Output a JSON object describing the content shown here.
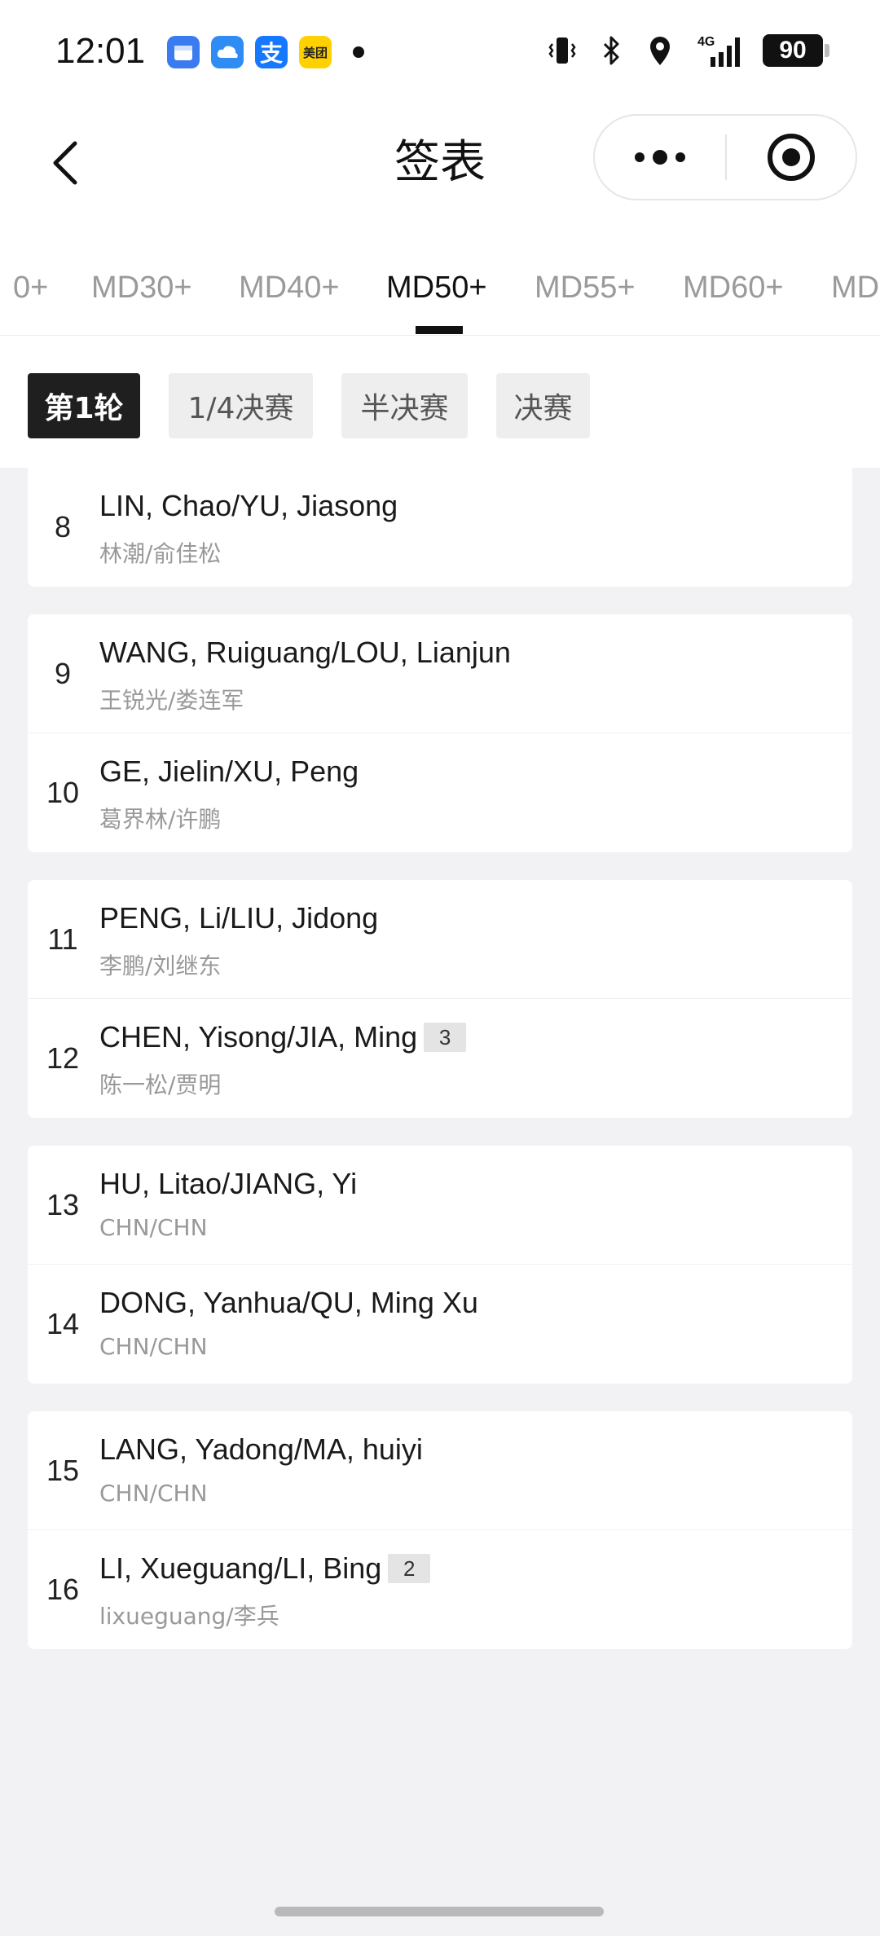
{
  "status_bar": {
    "time": "12:01",
    "battery": "90",
    "network": "4G",
    "app_icons": [
      "calendar-app-icon",
      "cloud-app-icon",
      "alipay-app-icon",
      "meituan-app-icon"
    ],
    "meituan_label": "美团",
    "alipay_label": "支"
  },
  "nav": {
    "title": "签表"
  },
  "category_tabs": [
    {
      "label": "0+",
      "active": false
    },
    {
      "label": "MD30+",
      "active": false
    },
    {
      "label": "MD40+",
      "active": false
    },
    {
      "label": "MD50+",
      "active": true
    },
    {
      "label": "MD55+",
      "active": false
    },
    {
      "label": "MD60+",
      "active": false
    },
    {
      "label": "MD",
      "active": false
    }
  ],
  "round_tabs": [
    {
      "label": "第1轮",
      "active": true
    },
    {
      "label": "1/4决赛",
      "active": false
    },
    {
      "label": "半决赛",
      "active": false
    },
    {
      "label": "决赛",
      "active": false
    }
  ],
  "groups": [
    {
      "entries": [
        {
          "no": "8",
          "names": "LIN, Chao/YU, Jiasong",
          "sub": "林潮/俞佳松",
          "seed": ""
        }
      ]
    },
    {
      "entries": [
        {
          "no": "9",
          "names": "WANG, Ruiguang/LOU, Lianjun",
          "sub": "王锐光/娄连军",
          "seed": ""
        },
        {
          "no": "10",
          "names": "GE, Jielin/XU, Peng",
          "sub": "葛界林/许鹏",
          "seed": ""
        }
      ]
    },
    {
      "entries": [
        {
          "no": "11",
          "names": "PENG, Li/LIU, Jidong",
          "sub": "李鹏/刘继东",
          "seed": ""
        },
        {
          "no": "12",
          "names": "CHEN, Yisong/JIA, Ming",
          "sub": "陈一松/贾明",
          "seed": "3"
        }
      ]
    },
    {
      "entries": [
        {
          "no": "13",
          "names": "HU, Litao/JIANG, Yi",
          "sub": "CHN/CHN",
          "seed": ""
        },
        {
          "no": "14",
          "names": "DONG, Yanhua/QU, Ming Xu",
          "sub": "CHN/CHN",
          "seed": ""
        }
      ]
    },
    {
      "entries": [
        {
          "no": "15",
          "names": "LANG, Yadong/MA, huiyi",
          "sub": "CHN/CHN",
          "seed": ""
        },
        {
          "no": "16",
          "names": "LI, Xueguang/LI, Bing",
          "sub": "lixueguang/李兵",
          "seed": "2"
        }
      ]
    }
  ],
  "colors": {
    "accent": "#1f1f1f",
    "muted_text": "#999999",
    "background": "#f2f2f4"
  }
}
